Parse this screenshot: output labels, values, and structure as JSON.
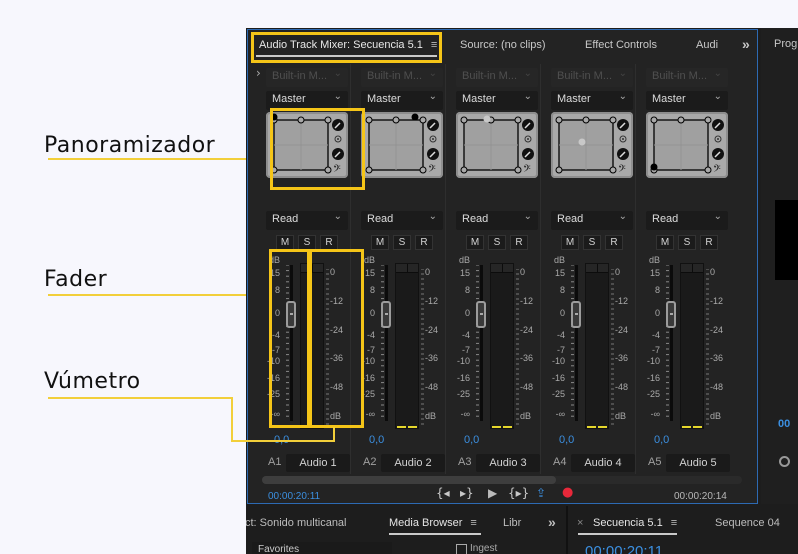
{
  "annotations": {
    "panner": "Panoramizador",
    "fader": "Fader",
    "vu_meter": "Vúmetro",
    "highlight_color": "#f5c518"
  },
  "mixer": {
    "tabs": [
      {
        "label": "Audio Track Mixer: Secuencia 5.1",
        "active": true
      },
      {
        "label": "Source: (no clips)",
        "active": false
      },
      {
        "label": "Effect Controls",
        "active": false
      },
      {
        "label": "Audi",
        "active": false
      }
    ],
    "overflow_glyph": "»",
    "expand_glyph": "›",
    "menu_glyph": "≡",
    "fader_scale": [
      "dB",
      "15",
      "8",
      "0",
      "-4",
      "-7",
      "-10",
      "-16",
      "-25",
      "-∞"
    ],
    "meter_scale": [
      "0",
      "-12",
      "-24",
      "-36",
      "-48",
      "dB"
    ],
    "tracks": [
      {
        "id": "A1",
        "name": "Audio 1",
        "effect": "Built-in M...",
        "output": "Master",
        "automation": "Read",
        "volume": "0,0",
        "fader_db": 0,
        "pan_position": "front-left"
      },
      {
        "id": "A2",
        "name": "Audio 2",
        "effect": "Built-in M...",
        "output": "Master",
        "automation": "Read",
        "volume": "0,0",
        "fader_db": 0,
        "pan_position": "front-right"
      },
      {
        "id": "A3",
        "name": "Audio 3",
        "effect": "Built-in M...",
        "output": "Master",
        "automation": "Read",
        "volume": "0,0",
        "fader_db": 0,
        "pan_position": "front-center"
      },
      {
        "id": "A4",
        "name": "Audio 4",
        "effect": "Built-in M...",
        "output": "Master",
        "automation": "Read",
        "volume": "0,0",
        "fader_db": 0,
        "pan_position": "center"
      },
      {
        "id": "A5",
        "name": "Audio 5",
        "effect": "Built-in M...",
        "output": "Master",
        "automation": "Read",
        "volume": "0,0",
        "fader_db": 0,
        "pan_position": "rear-left"
      }
    ],
    "msr_buttons": [
      "M",
      "S",
      "R"
    ],
    "timecode_current": "00:00:20:11",
    "timecode_duration": "00:00:20:14",
    "transport": {
      "go_to_in": "{◂",
      "go_to_out": "▸}",
      "play": "▶",
      "loop": "{▸}",
      "loop_active": "⇪",
      "record": "●"
    },
    "colors": {
      "accent_blue": "#3b8fe0",
      "record_red": "#e8283a",
      "peak_yellow": "#e5d72c"
    }
  },
  "program_monitor": {
    "tab_label": "Progr",
    "timecode_partial": "00"
  },
  "bottom_panels": {
    "left_tabs": [
      {
        "label": "ct: Sonido multicanal",
        "active": false
      },
      {
        "label": "Media Browser",
        "active": true
      },
      {
        "label": "Libr",
        "active": false
      }
    ],
    "favorites_dropdown": "Favorites",
    "ingest_label": "Ingest",
    "right_tabs": [
      {
        "label": "Secuencia 5.1",
        "active": true
      },
      {
        "label": "Sequence 04",
        "active": false
      }
    ],
    "timeline_timecode": "00:00:20:11",
    "close_glyph": "×"
  }
}
